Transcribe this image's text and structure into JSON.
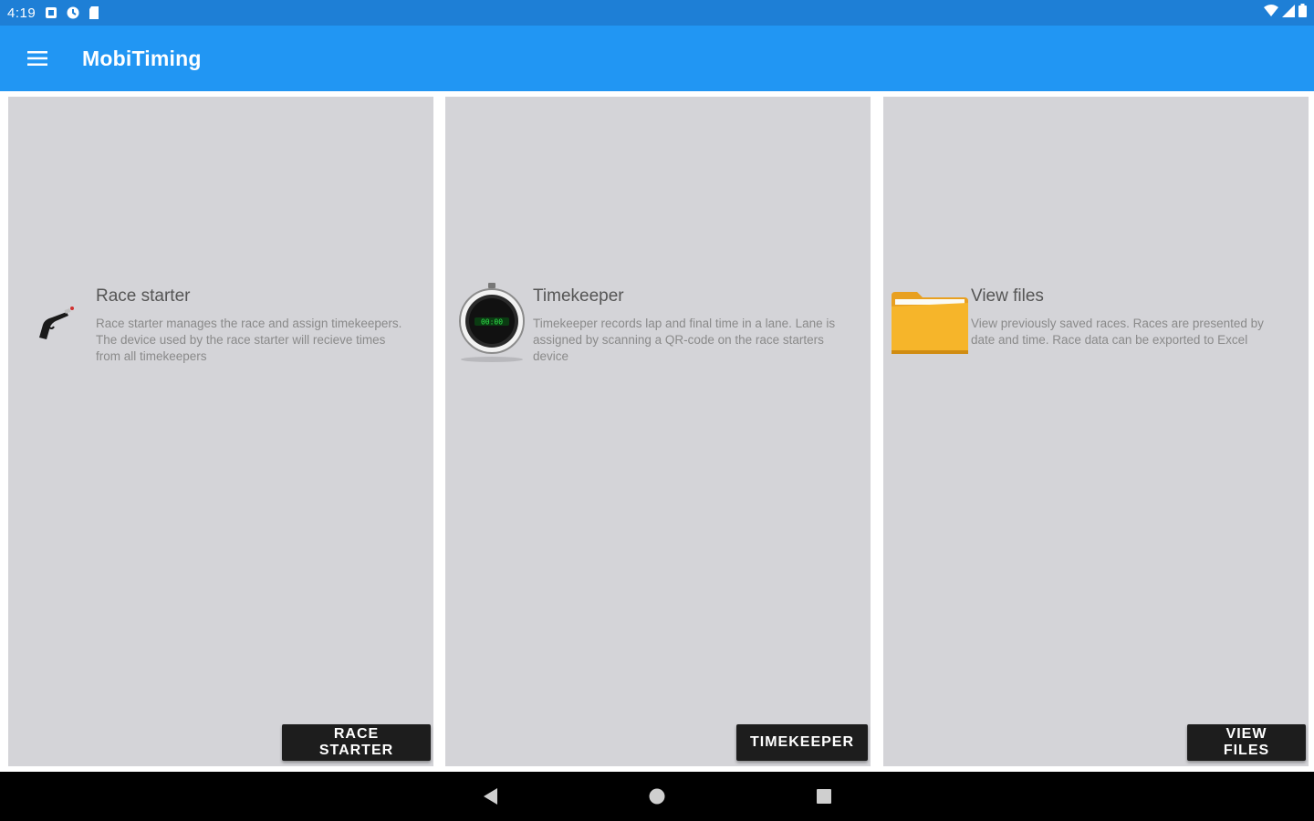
{
  "status_bar": {
    "time": "4:19",
    "icons_left": [
      "notification-icon",
      "notification-icon",
      "sd-card-icon"
    ],
    "icons_right": [
      "wifi-icon",
      "signal-icon",
      "battery-icon"
    ]
  },
  "app_bar": {
    "title": "MobiTiming",
    "menu_icon": "hamburger-menu-icon"
  },
  "cards": [
    {
      "title": "Race starter",
      "description": "Race starter manages the race and assign timekeepers. The device used by the race starter will recieve times from all timekeepers",
      "button_label": "RACE STARTER",
      "icon": "starter-pistol-icon"
    },
    {
      "title": "Timekeeper",
      "description": "Timekeeper records lap and final time in a lane. Lane is assigned by scanning a QR-code on the race starters device",
      "button_label": "TIMEKEEPER",
      "icon": "stopwatch-icon"
    },
    {
      "title": "View files",
      "description": "View previously saved races. Races are presented by date and time. Race data can be exported to Excel",
      "button_label": "VIEW FILES",
      "icon": "folder-icon"
    }
  ],
  "nav_bar": {
    "buttons": [
      "back-icon",
      "home-icon",
      "recents-icon"
    ]
  },
  "colors": {
    "status_bar": "#1e7fd6",
    "app_bar": "#2196f3",
    "card_bg": "#d4d4d8",
    "button_bg": "#1d1d1d",
    "nav_bar": "#000000"
  }
}
